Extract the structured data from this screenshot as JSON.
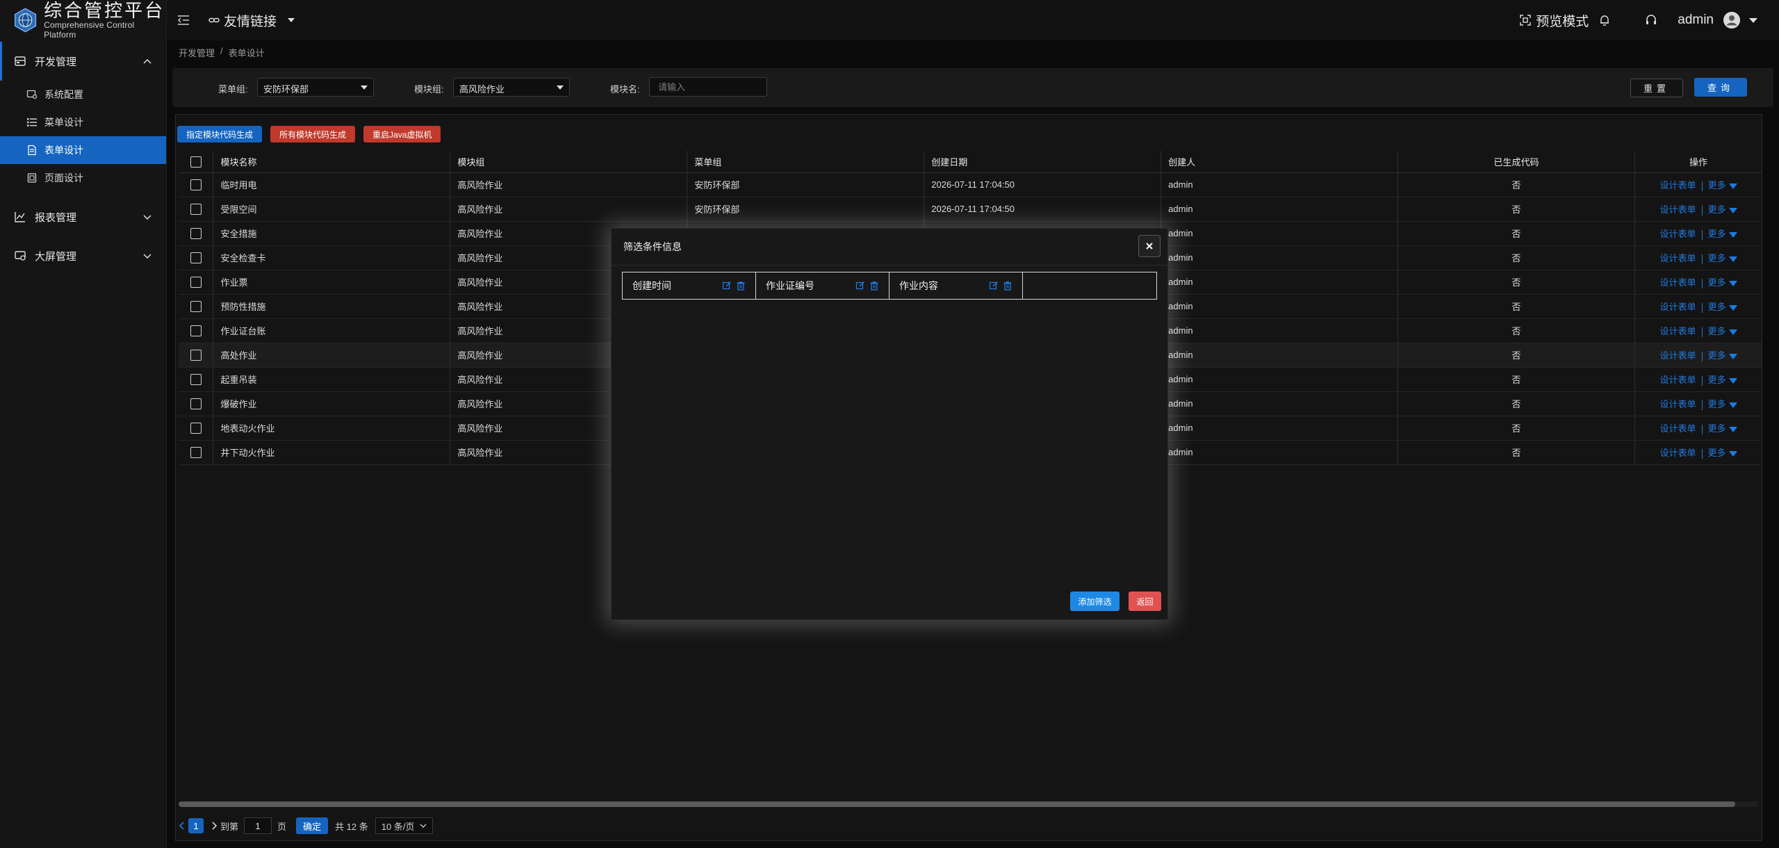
{
  "brand": {
    "title": "综合管控平台",
    "subtitle": "Comprehensive Control Platform"
  },
  "sidebar": {
    "groups": [
      {
        "label": "开发管理",
        "icon": "server-icon",
        "expanded": true,
        "items": [
          {
            "label": "系统配置",
            "icon": "monitor-icon",
            "active": false
          },
          {
            "label": "菜单设计",
            "icon": "list-icon",
            "active": false
          },
          {
            "label": "表单设计",
            "icon": "document-icon",
            "active": true
          },
          {
            "label": "页面设计",
            "icon": "page-icon",
            "active": false
          }
        ]
      },
      {
        "label": "报表管理",
        "icon": "chart-line-icon",
        "expanded": false
      },
      {
        "label": "大屏管理",
        "icon": "screen-icon",
        "expanded": false
      }
    ]
  },
  "header": {
    "quicklinks_label": "友情链接",
    "preview_label": "预览模式",
    "user": "admin"
  },
  "breadcrumb": [
    "开发管理",
    "/",
    "表单设计"
  ],
  "filter": {
    "menu_group_label": "菜单组:",
    "menu_group_value": "安防环保部",
    "module_group_label": "模块组:",
    "module_group_value": "高风险作业",
    "module_name_label": "模块名:",
    "module_name_placeholder": "请输入",
    "reset_label": "重置",
    "query_label": "查询"
  },
  "actions": {
    "gen_selected": "指定模块代码生成",
    "gen_all": "所有模块代码生成",
    "restart_jvm": "重启Java虚拟机"
  },
  "table": {
    "columns": [
      "模块名称",
      "模块组",
      "菜单组",
      "创建日期",
      "创建人",
      "已生成代码",
      "操作"
    ],
    "design_label": "设计表单",
    "more_label": "更多",
    "rows": [
      {
        "name": "临时用电",
        "module_group": "高风险作业",
        "menu_group": "安防环保部",
        "date": "2026-07-11 17:04:50",
        "creator": "admin",
        "generated": "否"
      },
      {
        "name": "受限空间",
        "module_group": "高风险作业",
        "menu_group": "安防环保部",
        "date": "2026-07-11 17:04:50",
        "creator": "admin",
        "generated": "否"
      },
      {
        "name": "安全措施",
        "module_group": "高风险作业",
        "menu_group": "",
        "date": "",
        "creator": "admin",
        "generated": "否"
      },
      {
        "name": "安全检查卡",
        "module_group": "高风险作业",
        "menu_group": "",
        "date": "",
        "creator": "admin",
        "generated": "否"
      },
      {
        "name": "作业票",
        "module_group": "高风险作业",
        "menu_group": "",
        "date": "",
        "creator": "admin",
        "generated": "否"
      },
      {
        "name": "预防性措施",
        "module_group": "高风险作业",
        "menu_group": "",
        "date": "",
        "creator": "admin",
        "generated": "否"
      },
      {
        "name": "作业证台账",
        "module_group": "高风险作业",
        "menu_group": "",
        "date": "",
        "creator": "admin",
        "generated": "否"
      },
      {
        "name": "高处作业",
        "module_group": "高风险作业",
        "menu_group": "",
        "date": "",
        "creator": "admin",
        "generated": "否"
      },
      {
        "name": "起重吊装",
        "module_group": "高风险作业",
        "menu_group": "",
        "date": "",
        "creator": "admin",
        "generated": "否"
      },
      {
        "name": "爆破作业",
        "module_group": "高风险作业",
        "menu_group": "",
        "date": "",
        "creator": "admin",
        "generated": "否"
      },
      {
        "name": "地表动火作业",
        "module_group": "高风险作业",
        "menu_group": "",
        "date": "",
        "creator": "admin",
        "generated": "否"
      },
      {
        "name": "井下动火作业",
        "module_group": "高风险作业",
        "menu_group": "",
        "date": "",
        "creator": "admin",
        "generated": "否"
      }
    ]
  },
  "pager": {
    "current": "1",
    "goto_label": "到第",
    "goto_value": "1",
    "page_unit": "页",
    "confirm_label": "确定",
    "total_label": "共 12 条",
    "page_size": "10 条/页"
  },
  "dialog": {
    "title": "筛选条件信息",
    "tags": [
      "创建时间",
      "作业证编号",
      "作业内容"
    ],
    "add_label": "添加筛选",
    "back_label": "返回"
  },
  "colors": {
    "accent": "#1565c0",
    "link": "#1f7ae0",
    "danger": "#c0392b",
    "dialog_add": "#1e88e5",
    "dialog_back": "#e05252"
  }
}
